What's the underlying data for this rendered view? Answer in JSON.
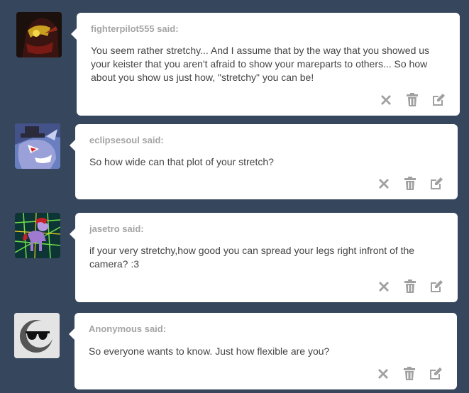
{
  "colors": {
    "background": "#36465d",
    "card": "#ffffff",
    "asker_name": "#a4a4a4",
    "question_text": "#444444",
    "action_icons": "#a0a0a0"
  },
  "posts": [
    {
      "asker_label": "fighterpilot555 said:",
      "question_lines": [
        "You seem rather stretchy... And I assume that by the way that you showed us",
        "your keister that you aren't afraid to show your mareparts to others... So how",
        "about you show us just how, \"stretchy\" you can be!"
      ]
    },
    {
      "asker_label": "eclipsesoul said:",
      "question_lines": [
        "So how wide can that plot of your stretch?"
      ]
    },
    {
      "asker_label": "jasetro said:",
      "question_lines": [
        "if your very stretchy,how good you can spread your legs right infront of the",
        "camera? :3"
      ]
    },
    {
      "asker_label": "Anonymous said:",
      "question_lines": [
        "So everyone wants to know. Just how flexible are you?"
      ]
    }
  ],
  "action_icons": [
    "close-icon",
    "trash-icon",
    "edit-icon"
  ]
}
